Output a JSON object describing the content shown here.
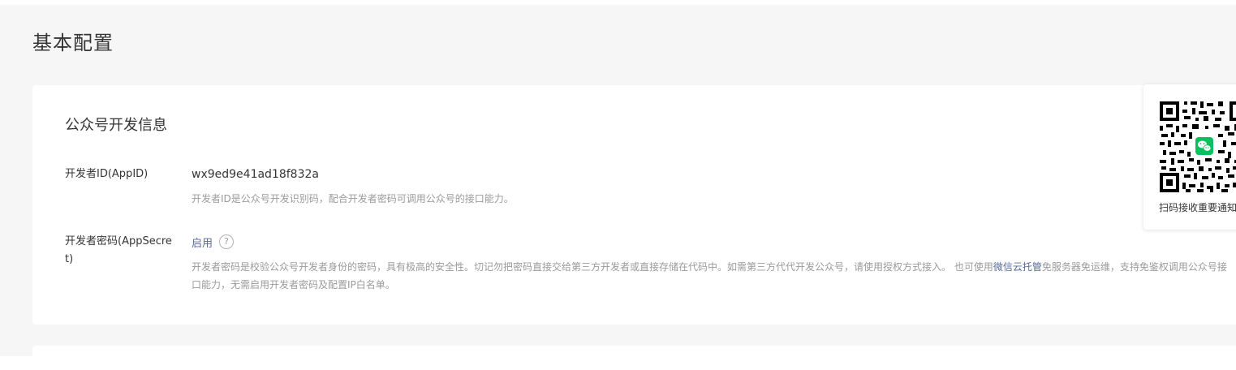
{
  "page": {
    "title": "基本配置"
  },
  "section": {
    "title": "公众号开发信息"
  },
  "appid": {
    "label": "开发者ID(AppID)",
    "value": "wx9ed9e41ad18f832a",
    "description": "开发者ID是公众号开发识别码，配合开发者密码可调用公众号的接口能力。"
  },
  "appsecret": {
    "label": "开发者密码(AppSecret)",
    "action_label": "启用",
    "help_glyph": "?",
    "description_before": "开发者密码是校验公众号开发者身份的密码，具有极高的安全性。切记勿把密码直接交给第三方开发者或直接存储在代码中。如需第三方代代开发公众号，请使用授权方式接入。 也可使用",
    "description_link": "微信云托管",
    "description_after": "免服务器免运维，支持免鉴权调用公众号接口能力，无需启用开发者密码及配置IP白名单。"
  },
  "qr_panel": {
    "caption": "扫码接收重要通知",
    "icon": "wechat-icon"
  },
  "colors": {
    "page_bg": "#f6f6f7",
    "card_bg": "#ffffff",
    "text": "#353535",
    "muted": "#9a9a9a",
    "link": "#576b95",
    "wechat_green": "#07c160"
  }
}
